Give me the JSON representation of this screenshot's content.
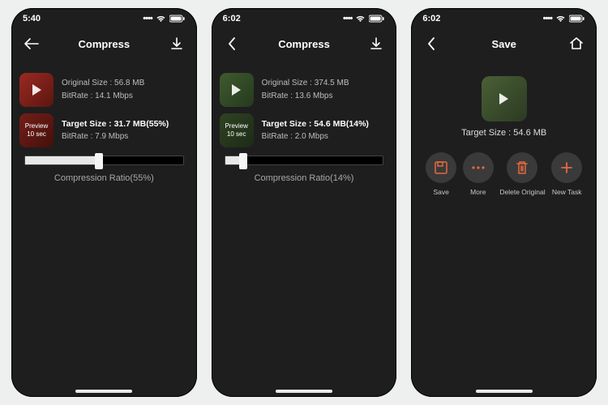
{
  "accent": "#e4693f",
  "screens": [
    {
      "time": "5:40",
      "title": "Compress",
      "rightIcon": "download",
      "original": {
        "sizeLabel": "Original Size : 56.8 MB",
        "bitrateLabel": "BitRate : 14.1 Mbps"
      },
      "target": {
        "sizeLabel": "Target Size : 31.7 MB(55%)",
        "bitrateLabel": "BitRate : 7.9 Mbps"
      },
      "previewBadgeTop": "Preview",
      "previewBadgeBottom": "10 sec",
      "ratioPercent": 55,
      "ratioLabel": "Compression Ratio(55%)",
      "thumbStyle": "red"
    },
    {
      "time": "6:02",
      "title": "Compress",
      "rightIcon": "download",
      "original": {
        "sizeLabel": "Original Size : 374.5 MB",
        "bitrateLabel": "BitRate : 13.6 Mbps"
      },
      "target": {
        "sizeLabel": "Target Size : 54.6 MB(14%)",
        "bitrateLabel": "BitRate : 2.0 Mbps"
      },
      "previewBadgeTop": "Preview",
      "previewBadgeBottom": "10 sec",
      "ratioPercent": 14,
      "ratioLabel": "Compression Ratio(14%)",
      "thumbStyle": "green"
    },
    {
      "time": "6:02",
      "title": "Save",
      "rightIcon": "home",
      "centerTargetLabel": "Target Size : 54.6 MB",
      "actions": [
        {
          "icon": "save",
          "label": "Save"
        },
        {
          "icon": "more",
          "label": "More"
        },
        {
          "icon": "trash",
          "label": "Delete Original"
        },
        {
          "icon": "plus",
          "label": "New Task"
        }
      ]
    }
  ]
}
